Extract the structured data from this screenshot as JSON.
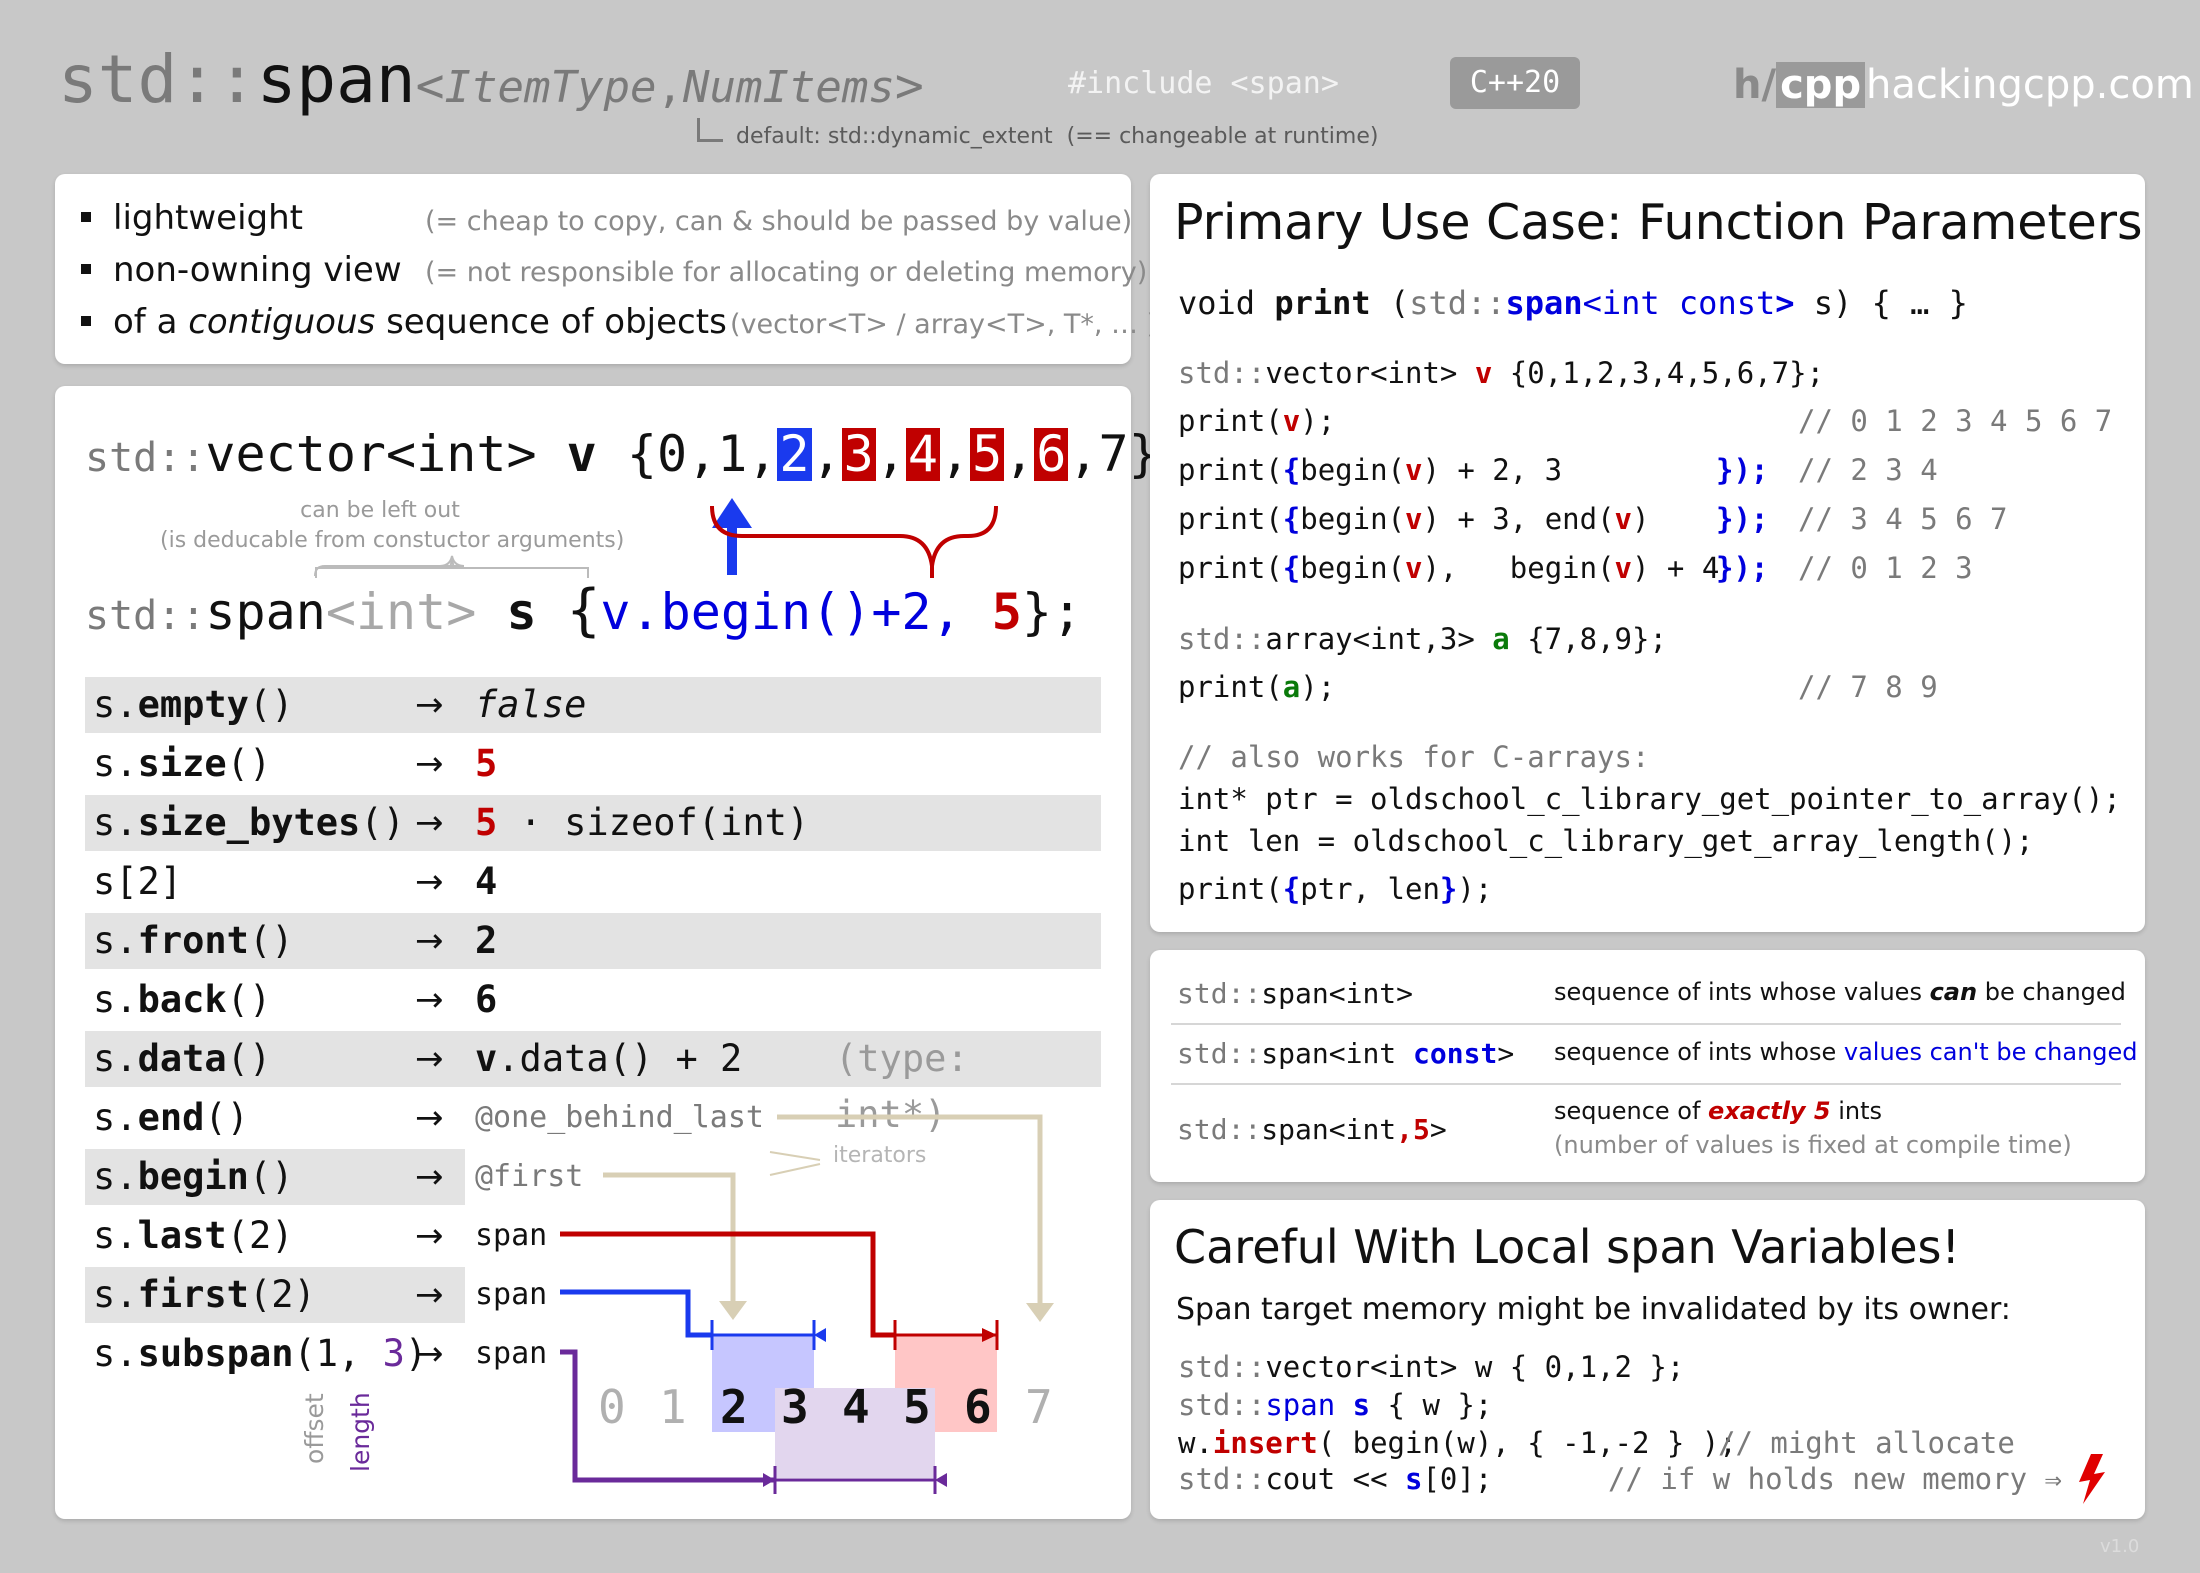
{
  "header": {
    "title_std": "std::",
    "title_span": "span",
    "title_lt": "<",
    "title_item": "ItemType",
    "title_comma": ",",
    "title_num": "NumItems",
    "title_gt": ">",
    "include": "#include <span>",
    "cpp_badge": "C++20",
    "default_note": "default: std::dynamic_extent",
    "default_note2": "(== changeable at runtime)",
    "logo_h": "h/",
    "logo_cpp": "cpp",
    "site": "hackingcpp.com"
  },
  "features": [
    {
      "label_pre": "lightweight",
      "label_em": "",
      "label_post": "",
      "note": "(= cheap to copy, can & should be passed by value)"
    },
    {
      "label_pre": "non-owning view",
      "label_em": "",
      "label_post": "",
      "note": "(= not responsible for allocating or deleting memory)"
    },
    {
      "label_pre": "of a ",
      "label_em": "contiguous",
      "label_post": " sequence of objects",
      "note": "(vector<T> / array<T>, T*, … )"
    }
  ],
  "left": {
    "vec_std": "std::",
    "vec_type": "vector<int>",
    "vec_name": "v",
    "vec_open": "{0,1,",
    "el2": "2",
    "el3": "3",
    "el4": "4",
    "el5": "5",
    "el6": "6",
    "vec_close": ",7};",
    "comma": ",",
    "left_out1": "can be left out",
    "left_out2": "(is deducable from constuctor arguments)",
    "span_std": "std::",
    "span_name": "span",
    "span_tmpl": "<int>",
    "span_var": "s",
    "span_open": "{",
    "span_arg1": "v.begin()+2,",
    "span_arg2": "5",
    "span_close": "};",
    "rows": [
      {
        "obj": "s.",
        "fn": "empty",
        "args": "()",
        "arrow": "→",
        "res": "false"
      },
      {
        "obj": "s.",
        "fn": "size",
        "args": "()",
        "arrow": "→",
        "res": "5"
      },
      {
        "obj": "s.",
        "fn": "size_bytes",
        "args": "()",
        "arrow": "→",
        "res": "5",
        "res2": "· sizeof(int)"
      },
      {
        "obj": "s[2]",
        "fn": "",
        "args": "",
        "arrow": "→",
        "res": "4"
      },
      {
        "obj": "s.",
        "fn": "front",
        "args": "()",
        "arrow": "→",
        "res": "2"
      },
      {
        "obj": "s.",
        "fn": "back",
        "args": "()",
        "arrow": "→",
        "res": "6"
      },
      {
        "obj": "s.",
        "fn": "data",
        "args": "()",
        "arrow": "→",
        "res": "v",
        "res2": ".data() + 2",
        "res3": "(type: int*)"
      },
      {
        "obj": "s.",
        "fn": "end",
        "args": "()",
        "arrow": "→",
        "res": "@one_behind_last"
      },
      {
        "obj": "s.",
        "fn": "begin",
        "args": "()",
        "arrow": "→",
        "res": "@first"
      },
      {
        "obj": "s.",
        "fn": "last",
        "args": "(2)",
        "arrow": "→",
        "res": "span"
      },
      {
        "obj": "s.",
        "fn": "first",
        "args": "(2)",
        "arrow": "→",
        "res": "span"
      },
      {
        "obj": "s.",
        "fn": "subspan",
        "args": "(1, ",
        "args2": "3",
        "args3": ")",
        "arrow": "→",
        "res": "span"
      }
    ],
    "iterators": "iterators",
    "offset": "offset",
    "length": "length",
    "digits": [
      "0",
      "1",
      "2",
      "3",
      "4",
      "5",
      "6",
      "7"
    ]
  },
  "primary": {
    "title": "Primary Use Case: Function Parameters",
    "sig_void": "void ",
    "sig_print": "print",
    "sig_open": " (",
    "sig_std": "std::",
    "sig_span": "span",
    "sig_int": "<int ",
    "sig_const": "const",
    "sig_gt": ">",
    "sig_rest": " s) { … }",
    "l1_std": "std::",
    "l1_type": "vector<int> ",
    "l1_v": "v",
    "l1_rest": " {0,1,2,3,4,5,6,7};",
    "l2_a": "print(",
    "l2_v": "v",
    "l2_b": ");",
    "l2_c": "// 0 1 2 3 4 5 6 7",
    "l3_a": "print(",
    "l3_b": "{",
    "l3_c": "begin(",
    "l3_v": "v",
    "l3_d": ") + 2,  3",
    "l3_e": "});",
    "l3_f": "// 2 3 4",
    "l4_a": "print(",
    "l4_b": "{",
    "l4_c": "begin(",
    "l4_v": "v",
    "l4_d": ") + 3,",
    "l4_d2": " end(",
    "l4_v2": "v",
    "l4_d3": ")",
    "l4_e": "});",
    "l4_f": "// 3 4 5 6 7",
    "l5_a": "print(",
    "l5_b": "{",
    "l5_c": "begin(",
    "l5_v": "v",
    "l5_d": "),",
    "l5_d2": "begin(",
    "l5_v2": "v",
    "l5_d3": ") + 4",
    "l5_e": "});",
    "l5_f": "// 0 1 2 3",
    "l6_std": "std::",
    "l6_type": "array<int,3> ",
    "l6_a": "a",
    "l6_rest": " {7,8,9};",
    "l7_a": "print(",
    "l7_v": "a",
    "l7_b": ");",
    "l7_c": "// 7 8 9",
    "c_comment": "// also works for C-arrays:",
    "c1": "int* ptr = oldschool_c_library_get_pointer_to_array();",
    "c2": "int  len = oldschool_c_library_get_array_length();",
    "c3_a": "print(",
    "c3_b": "{",
    "c3_c": "ptr, len",
    "c3_d": "}",
    "c3_e": ");"
  },
  "seq": [
    {
      "std": "std::",
      "type": "span<int>",
      "kw": "",
      "tail": "",
      "desc_a": "sequence of ints whose values ",
      "desc_b": "can",
      "desc_c": " be changed"
    },
    {
      "std": "std::",
      "type": "span<int ",
      "kw": "const",
      "tail": ">",
      "desc_a": "sequence of ints whose ",
      "desc_b": "values can't be changed",
      "desc_c": ""
    },
    {
      "std": "std::",
      "type": "span<int",
      "kw": ",5",
      "tail": ">",
      "desc_a": "sequence of ",
      "desc_b": "exactly 5",
      "desc_c": " ints",
      "desc_d": "(number of values is fixed at compile time)"
    }
  ],
  "careful": {
    "title": "Careful With Local span Variables!",
    "subtitle": "Span target memory might be invalidated by its owner:",
    "l1_std": "std::",
    "l1_type": "vector<int> ",
    "l1_w": "w",
    "l1_rest": " { 0,1,2 };",
    "l2_std": "std::",
    "l2_span": "span ",
    "l2_s": "s",
    "l2_rest": " { w };",
    "l3_w": "w.",
    "l3_ins": "insert",
    "l3_rest": "( begin(w), { -1,-2 } );",
    "l3_cm": "// might allocate",
    "l4_std": "std::",
    "l4_cout": "cout << ",
    "l4_s": "s",
    "l4_rest": "[0];",
    "l4_cm": "// if w holds new memory ⇒"
  },
  "version": "v1.0"
}
